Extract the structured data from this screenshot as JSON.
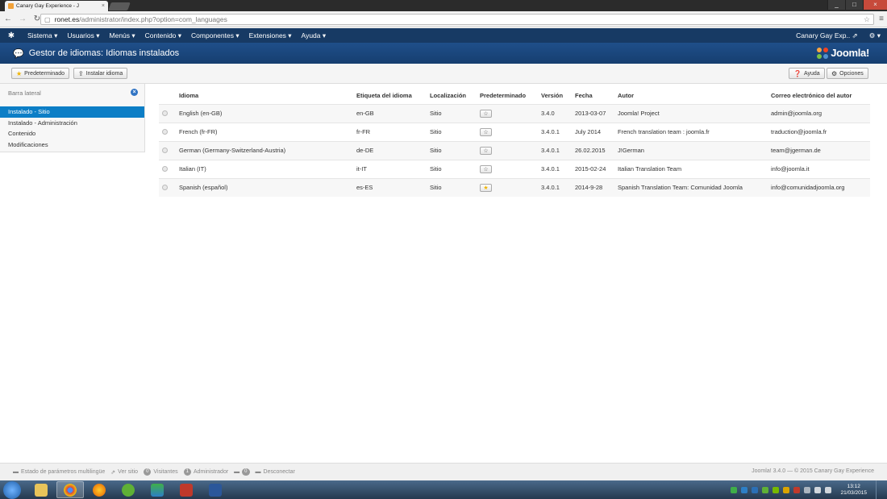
{
  "browser": {
    "tab_title": "Canary Gay Experience - J",
    "tab_close": "×",
    "url_host": "ronet.es",
    "url_path": "/administrator/index.php?option=com_languages",
    "window_controls": [
      "_",
      "□",
      "×"
    ]
  },
  "admin_menu": {
    "items": [
      "Sistema ▾",
      "Usuarios ▾",
      "Menús ▾",
      "Contenido ▾",
      "Componentes ▾",
      "Extensiones ▾",
      "Ayuda ▾"
    ],
    "site_link": "Canary Gay Exp.. ⇗",
    "settings": "⚙ ▾"
  },
  "header": {
    "title": "Gestor de idiomas: Idiomas instalados",
    "brand": "Joomla!"
  },
  "toolbar": {
    "default_label": "Predeterminado",
    "install_label": "Instalar idioma",
    "help_label": "Ayuda",
    "options_label": "Opciones"
  },
  "sidebar": {
    "title": "Barra lateral",
    "items": [
      "Instalado - Sitio",
      "Instalado - Administración",
      "Contenido",
      "Modificaciones"
    ]
  },
  "table": {
    "headers": [
      "Idioma",
      "Etiqueta del idioma",
      "Localización",
      "Predeterminado",
      "Versión",
      "Fecha",
      "Autor",
      "Correo electrónico del autor"
    ],
    "rows": [
      {
        "lang": "English (en-GB)",
        "tag": "en-GB",
        "loc": "Sitio",
        "default": false,
        "version": "3.4.0",
        "date": "2013-03-07",
        "author": "Joomla! Project",
        "email": "admin@joomla.org"
      },
      {
        "lang": "French (fr-FR)",
        "tag": "fr-FR",
        "loc": "Sitio",
        "default": false,
        "version": "3.4.0.1",
        "date": "July 2014",
        "author": "French translation team : joomla.fr",
        "email": "traduction@joomla.fr"
      },
      {
        "lang": "German (Germany-Switzerland-Austria)",
        "tag": "de-DE",
        "loc": "Sitio",
        "default": false,
        "version": "3.4.0.1",
        "date": "26.02.2015",
        "author": "J!German",
        "email": "team@jgerman.de"
      },
      {
        "lang": "Italian (IT)",
        "tag": "it-IT",
        "loc": "Sitio",
        "default": false,
        "version": "3.4.0.1",
        "date": "2015-02-24",
        "author": "Italian Translation Team",
        "email": "info@joomla.it"
      },
      {
        "lang": "Spanish (español)",
        "tag": "es-ES",
        "loc": "Sitio",
        "default": true,
        "version": "3.4.0.1",
        "date": "2014-9-28",
        "author": "Spanish Translation Team: Comunidad Joomla",
        "email": "info@comunidadjoomla.org"
      }
    ]
  },
  "statusbar": {
    "multilang": "Estado de parámetros multilingüe",
    "view_site": "Ver sitio",
    "visitors_count": "0",
    "visitors_label": "Visitantes",
    "admin_count": "1",
    "admin_label": "Administrador",
    "messages_count": "0",
    "logout": "Desconectar",
    "copyright": "Joomla! 3.4.0 — © 2015 Canary Gay Experience"
  },
  "taskbar": {
    "time": "13:12",
    "date": "21/03/2015"
  },
  "colors": {
    "menu_bg": "#173a64",
    "header_bg": "#1f4f8a",
    "active_item": "#0c7ec6",
    "star_on": "#f0b400"
  }
}
